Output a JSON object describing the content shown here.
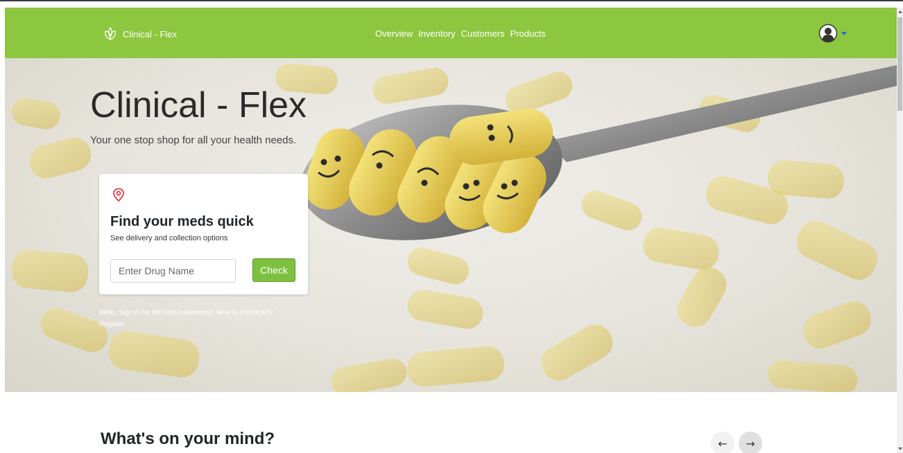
{
  "brand": {
    "name": "Clinical - Flex",
    "logo_icon": "leaf-logo-icon"
  },
  "nav": {
    "links": [
      "Overview",
      "Inventory",
      "Customers",
      "Products"
    ]
  },
  "user_menu": {
    "icon": "user-avatar-icon",
    "dropdown_icon": "caret-down-icon"
  },
  "hero": {
    "title": "Clinical - Flex",
    "subtitle": "Your one stop shop for all your health needs."
  },
  "search_card": {
    "icon": "map-pin-icon",
    "title": "Find your meds quick",
    "description": "See delivery and collection options",
    "input_placeholder": "Enter Drug Name",
    "input_value": "",
    "button_label": "Check"
  },
  "signin": {
    "text": "Hello, Sign in for the best experience. New to Freshcart?",
    "register_label": "Register"
  },
  "section": {
    "title": "What's on your mind?",
    "prev_arrow": "←",
    "next_arrow": "→"
  },
  "colors": {
    "navbar": "#8dc63f",
    "button": "#7ec140",
    "pin": "#e5353b",
    "caret": "#1e6fd9"
  }
}
